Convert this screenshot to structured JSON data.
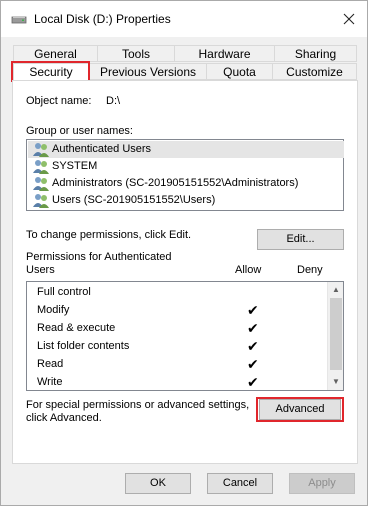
{
  "window": {
    "title": "Local Disk (D:) Properties"
  },
  "tabs_row1": [
    {
      "label": "General"
    },
    {
      "label": "Tools"
    },
    {
      "label": "Hardware"
    },
    {
      "label": "Sharing"
    }
  ],
  "tabs_row2": [
    {
      "label": "Security",
      "active": true
    },
    {
      "label": "Previous Versions"
    },
    {
      "label": "Quota"
    },
    {
      "label": "Customize"
    }
  ],
  "security": {
    "object_name_label": "Object name:",
    "object_name_value": "D:\\",
    "group_label": "Group or user names:",
    "users": [
      {
        "name": "Authenticated Users",
        "selected": true
      },
      {
        "name": "SYSTEM"
      },
      {
        "name": "Administrators (SC-201905151552\\Administrators)"
      },
      {
        "name": "Users (SC-201905151552\\Users)"
      }
    ],
    "change_text": "To change permissions, click Edit.",
    "edit_label": "Edit...",
    "permissions_label_line1": "Permissions for Authenticated",
    "permissions_label_line2": "Users",
    "allow_header": "Allow",
    "deny_header": "Deny",
    "permissions": [
      {
        "name": "Full control",
        "allow": false,
        "deny": false
      },
      {
        "name": "Modify",
        "allow": true,
        "deny": false
      },
      {
        "name": "Read & execute",
        "allow": true,
        "deny": false
      },
      {
        "name": "List folder contents",
        "allow": true,
        "deny": false
      },
      {
        "name": "Read",
        "allow": true,
        "deny": false
      },
      {
        "name": "Write",
        "allow": true,
        "deny": false
      }
    ],
    "special_text_line1": "For special permissions or advanced settings,",
    "special_text_line2": "click Advanced.",
    "advanced_label": "Advanced"
  },
  "footer": {
    "ok_label": "OK",
    "cancel_label": "Cancel",
    "apply_label": "Apply"
  },
  "colors": {
    "highlight": "#e0262c"
  }
}
